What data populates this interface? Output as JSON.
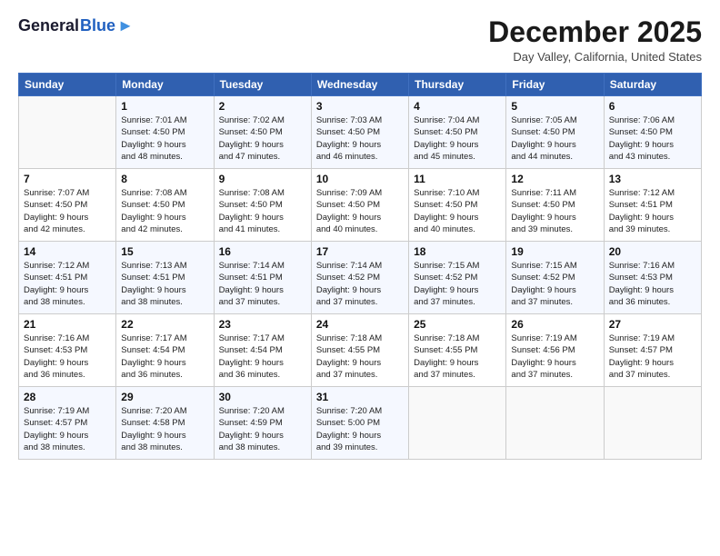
{
  "header": {
    "logo_general": "General",
    "logo_blue": "Blue",
    "month_title": "December 2025",
    "location": "Day Valley, California, United States"
  },
  "weekdays": [
    "Sunday",
    "Monday",
    "Tuesday",
    "Wednesday",
    "Thursday",
    "Friday",
    "Saturday"
  ],
  "weeks": [
    [
      {
        "day": "",
        "info": ""
      },
      {
        "day": "1",
        "info": "Sunrise: 7:01 AM\nSunset: 4:50 PM\nDaylight: 9 hours\nand 48 minutes."
      },
      {
        "day": "2",
        "info": "Sunrise: 7:02 AM\nSunset: 4:50 PM\nDaylight: 9 hours\nand 47 minutes."
      },
      {
        "day": "3",
        "info": "Sunrise: 7:03 AM\nSunset: 4:50 PM\nDaylight: 9 hours\nand 46 minutes."
      },
      {
        "day": "4",
        "info": "Sunrise: 7:04 AM\nSunset: 4:50 PM\nDaylight: 9 hours\nand 45 minutes."
      },
      {
        "day": "5",
        "info": "Sunrise: 7:05 AM\nSunset: 4:50 PM\nDaylight: 9 hours\nand 44 minutes."
      },
      {
        "day": "6",
        "info": "Sunrise: 7:06 AM\nSunset: 4:50 PM\nDaylight: 9 hours\nand 43 minutes."
      }
    ],
    [
      {
        "day": "7",
        "info": "Sunrise: 7:07 AM\nSunset: 4:50 PM\nDaylight: 9 hours\nand 42 minutes."
      },
      {
        "day": "8",
        "info": "Sunrise: 7:08 AM\nSunset: 4:50 PM\nDaylight: 9 hours\nand 42 minutes."
      },
      {
        "day": "9",
        "info": "Sunrise: 7:08 AM\nSunset: 4:50 PM\nDaylight: 9 hours\nand 41 minutes."
      },
      {
        "day": "10",
        "info": "Sunrise: 7:09 AM\nSunset: 4:50 PM\nDaylight: 9 hours\nand 40 minutes."
      },
      {
        "day": "11",
        "info": "Sunrise: 7:10 AM\nSunset: 4:50 PM\nDaylight: 9 hours\nand 40 minutes."
      },
      {
        "day": "12",
        "info": "Sunrise: 7:11 AM\nSunset: 4:50 PM\nDaylight: 9 hours\nand 39 minutes."
      },
      {
        "day": "13",
        "info": "Sunrise: 7:12 AM\nSunset: 4:51 PM\nDaylight: 9 hours\nand 39 minutes."
      }
    ],
    [
      {
        "day": "14",
        "info": "Sunrise: 7:12 AM\nSunset: 4:51 PM\nDaylight: 9 hours\nand 38 minutes."
      },
      {
        "day": "15",
        "info": "Sunrise: 7:13 AM\nSunset: 4:51 PM\nDaylight: 9 hours\nand 38 minutes."
      },
      {
        "day": "16",
        "info": "Sunrise: 7:14 AM\nSunset: 4:51 PM\nDaylight: 9 hours\nand 37 minutes."
      },
      {
        "day": "17",
        "info": "Sunrise: 7:14 AM\nSunset: 4:52 PM\nDaylight: 9 hours\nand 37 minutes."
      },
      {
        "day": "18",
        "info": "Sunrise: 7:15 AM\nSunset: 4:52 PM\nDaylight: 9 hours\nand 37 minutes."
      },
      {
        "day": "19",
        "info": "Sunrise: 7:15 AM\nSunset: 4:52 PM\nDaylight: 9 hours\nand 37 minutes."
      },
      {
        "day": "20",
        "info": "Sunrise: 7:16 AM\nSunset: 4:53 PM\nDaylight: 9 hours\nand 36 minutes."
      }
    ],
    [
      {
        "day": "21",
        "info": "Sunrise: 7:16 AM\nSunset: 4:53 PM\nDaylight: 9 hours\nand 36 minutes."
      },
      {
        "day": "22",
        "info": "Sunrise: 7:17 AM\nSunset: 4:54 PM\nDaylight: 9 hours\nand 36 minutes."
      },
      {
        "day": "23",
        "info": "Sunrise: 7:17 AM\nSunset: 4:54 PM\nDaylight: 9 hours\nand 36 minutes."
      },
      {
        "day": "24",
        "info": "Sunrise: 7:18 AM\nSunset: 4:55 PM\nDaylight: 9 hours\nand 37 minutes."
      },
      {
        "day": "25",
        "info": "Sunrise: 7:18 AM\nSunset: 4:55 PM\nDaylight: 9 hours\nand 37 minutes."
      },
      {
        "day": "26",
        "info": "Sunrise: 7:19 AM\nSunset: 4:56 PM\nDaylight: 9 hours\nand 37 minutes."
      },
      {
        "day": "27",
        "info": "Sunrise: 7:19 AM\nSunset: 4:57 PM\nDaylight: 9 hours\nand 37 minutes."
      }
    ],
    [
      {
        "day": "28",
        "info": "Sunrise: 7:19 AM\nSunset: 4:57 PM\nDaylight: 9 hours\nand 38 minutes."
      },
      {
        "day": "29",
        "info": "Sunrise: 7:20 AM\nSunset: 4:58 PM\nDaylight: 9 hours\nand 38 minutes."
      },
      {
        "day": "30",
        "info": "Sunrise: 7:20 AM\nSunset: 4:59 PM\nDaylight: 9 hours\nand 38 minutes."
      },
      {
        "day": "31",
        "info": "Sunrise: 7:20 AM\nSunset: 5:00 PM\nDaylight: 9 hours\nand 39 minutes."
      },
      {
        "day": "",
        "info": ""
      },
      {
        "day": "",
        "info": ""
      },
      {
        "day": "",
        "info": ""
      }
    ]
  ]
}
